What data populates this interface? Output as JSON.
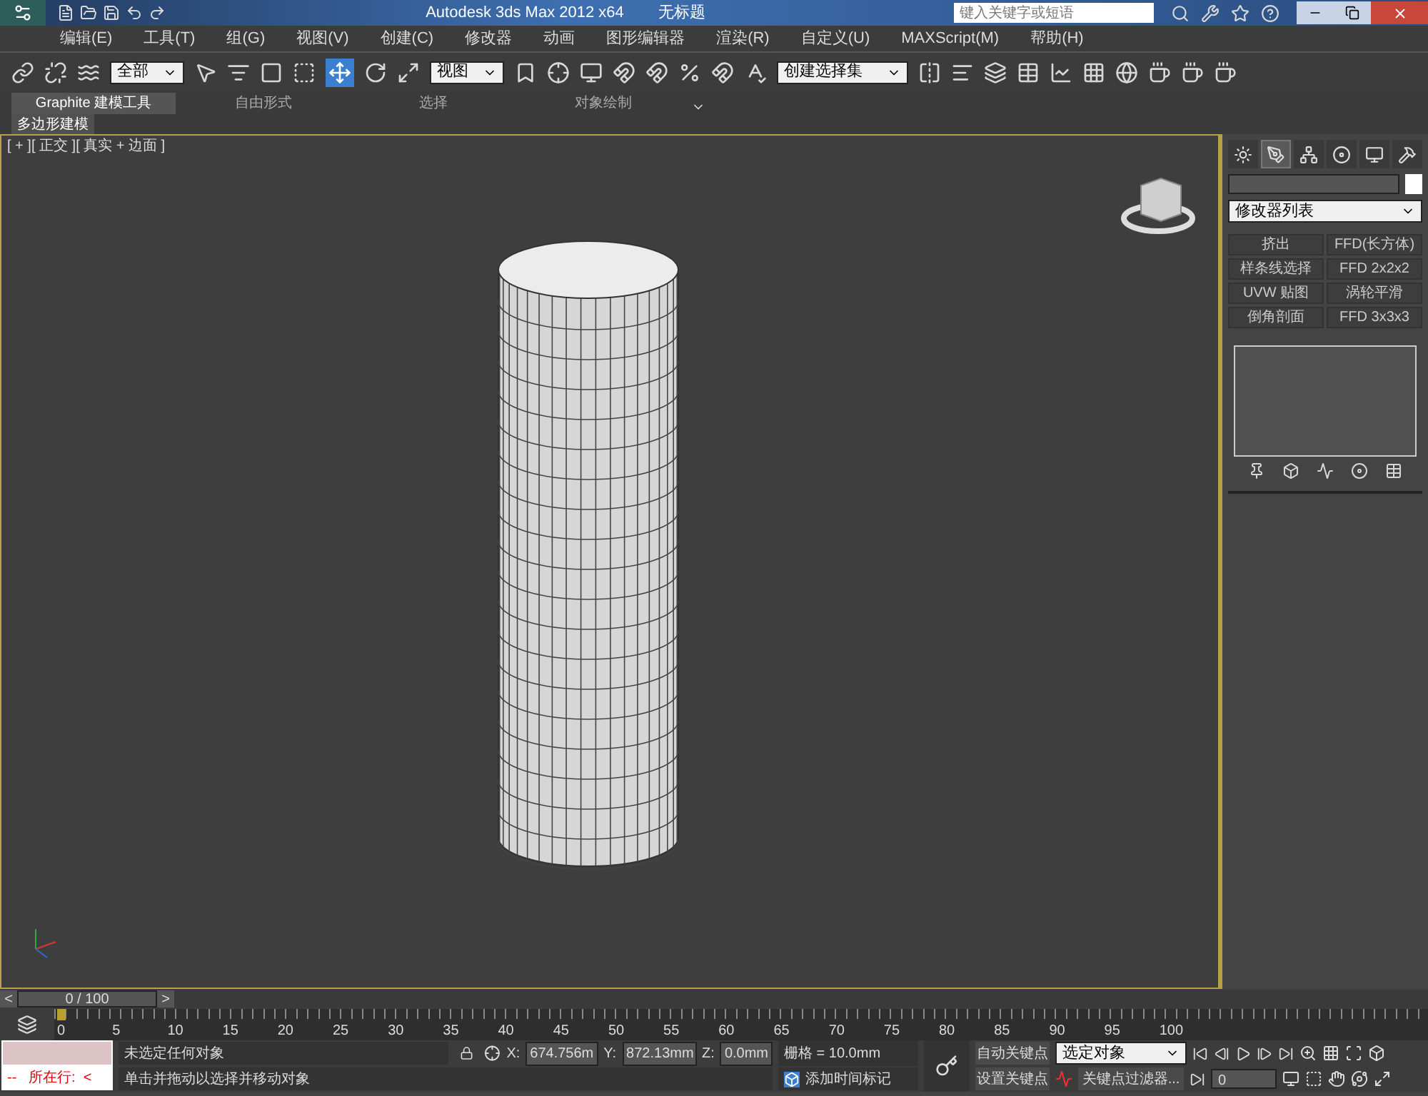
{
  "title_bar": {
    "title": "Autodesk 3ds Max  2012 x64",
    "document": "无标题",
    "search": {
      "placeholder": "键入关键字或短语"
    }
  },
  "menu": [
    "编辑(E)",
    "工具(T)",
    "组(G)",
    "视图(V)",
    "创建(C)",
    "修改器",
    "动画",
    "图形编辑器",
    "渲染(R)",
    "自定义(U)",
    "MAXScript(M)",
    "帮助(H)"
  ],
  "toolbar": {
    "selection_filter": "全部",
    "reference_coord": "视图",
    "named_selection": "创建选择集"
  },
  "ribbon": {
    "tabs": [
      {
        "label": "Graphite 建模工具",
        "selected": true
      },
      {
        "label": "自由形式",
        "selected": false
      },
      {
        "label": "选择",
        "selected": false
      },
      {
        "label": "对象绘制",
        "selected": false
      }
    ],
    "panel": "多边形建模"
  },
  "viewport": {
    "label": "[ + ][ 正交 ][ 真实 + 边面 ]"
  },
  "command_panel": {
    "tabs": [
      {
        "selected": false
      },
      {
        "selected": true
      },
      {
        "selected": false
      },
      {
        "selected": false
      },
      {
        "selected": false
      },
      {
        "selected": false
      }
    ],
    "modifier_list": "修改器列表",
    "modifier_buttons": [
      "挤出",
      "FFD(长方体)",
      "样条线选择",
      "FFD 2x2x2",
      "UVW 贴图",
      "涡轮平滑",
      "倒角剖面",
      "FFD 3x3x3"
    ]
  },
  "time_slider": {
    "prev": "<",
    "frame": "0 / 100",
    "next": ">"
  },
  "track_bar": {
    "ticks": [
      "0",
      "5",
      "10",
      "15",
      "20",
      "25",
      "30",
      "35",
      "40",
      "45",
      "50",
      "55",
      "60",
      "65",
      "70",
      "75",
      "80",
      "85",
      "90",
      "95",
      "100"
    ]
  },
  "status": {
    "script_line": "--   所在行:  <",
    "selection_info": "未选定任何对象",
    "prompt": "单击并拖动以选择并移动对象",
    "x_label": "X:",
    "x": "674.756m",
    "y_label": "Y:",
    "y": "872.13mm",
    "z_label": "Z:",
    "z": "0.0mm",
    "grid": "栅格 = 10.0mm",
    "add_time_tag": "添加时间标记",
    "auto_key": "自动关键点",
    "set_key": "设置关键点",
    "key_mode": "选定对象",
    "key_filters": "关键点过滤器...",
    "frame": "0"
  }
}
